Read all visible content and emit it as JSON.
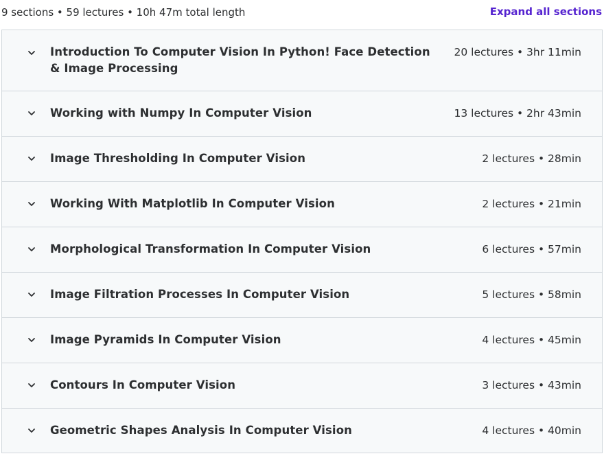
{
  "summary": {
    "text": "9 sections • 59 lectures • 10h 47m total length",
    "expand_label": "Expand all sections"
  },
  "colors": {
    "accent": "#5624d0",
    "section_background": "#f7f9fa",
    "border": "#d1d7dc",
    "text": "#2d2f31"
  },
  "sections": [
    {
      "title": "Introduction To Computer Vision In Python! Face Detection & Image Processing",
      "meta": "20 lectures • 3hr 11min",
      "icon": "chevron-down-icon"
    },
    {
      "title": "Working with Numpy In Computer Vision",
      "meta": "13 lectures • 2hr 43min",
      "icon": "chevron-down-icon"
    },
    {
      "title": "Image Thresholding In Computer Vision",
      "meta": "2 lectures • 28min",
      "icon": "chevron-down-icon"
    },
    {
      "title": "Working With Matplotlib In Computer Vision",
      "meta": "2 lectures • 21min",
      "icon": "chevron-down-icon"
    },
    {
      "title": "Morphological Transformation In Computer Vision",
      "meta": "6 lectures • 57min",
      "icon": "chevron-down-icon"
    },
    {
      "title": "Image Filtration Processes In Computer Vision",
      "meta": "5 lectures • 58min",
      "icon": "chevron-down-icon"
    },
    {
      "title": "Image Pyramids In Computer Vision",
      "meta": "4 lectures • 45min",
      "icon": "chevron-down-icon"
    },
    {
      "title": "Contours In Computer Vision",
      "meta": "3 lectures • 43min",
      "icon": "chevron-down-icon"
    },
    {
      "title": "Geometric Shapes Analysis In Computer Vision",
      "meta": "4 lectures • 40min",
      "icon": "chevron-down-icon"
    }
  ]
}
